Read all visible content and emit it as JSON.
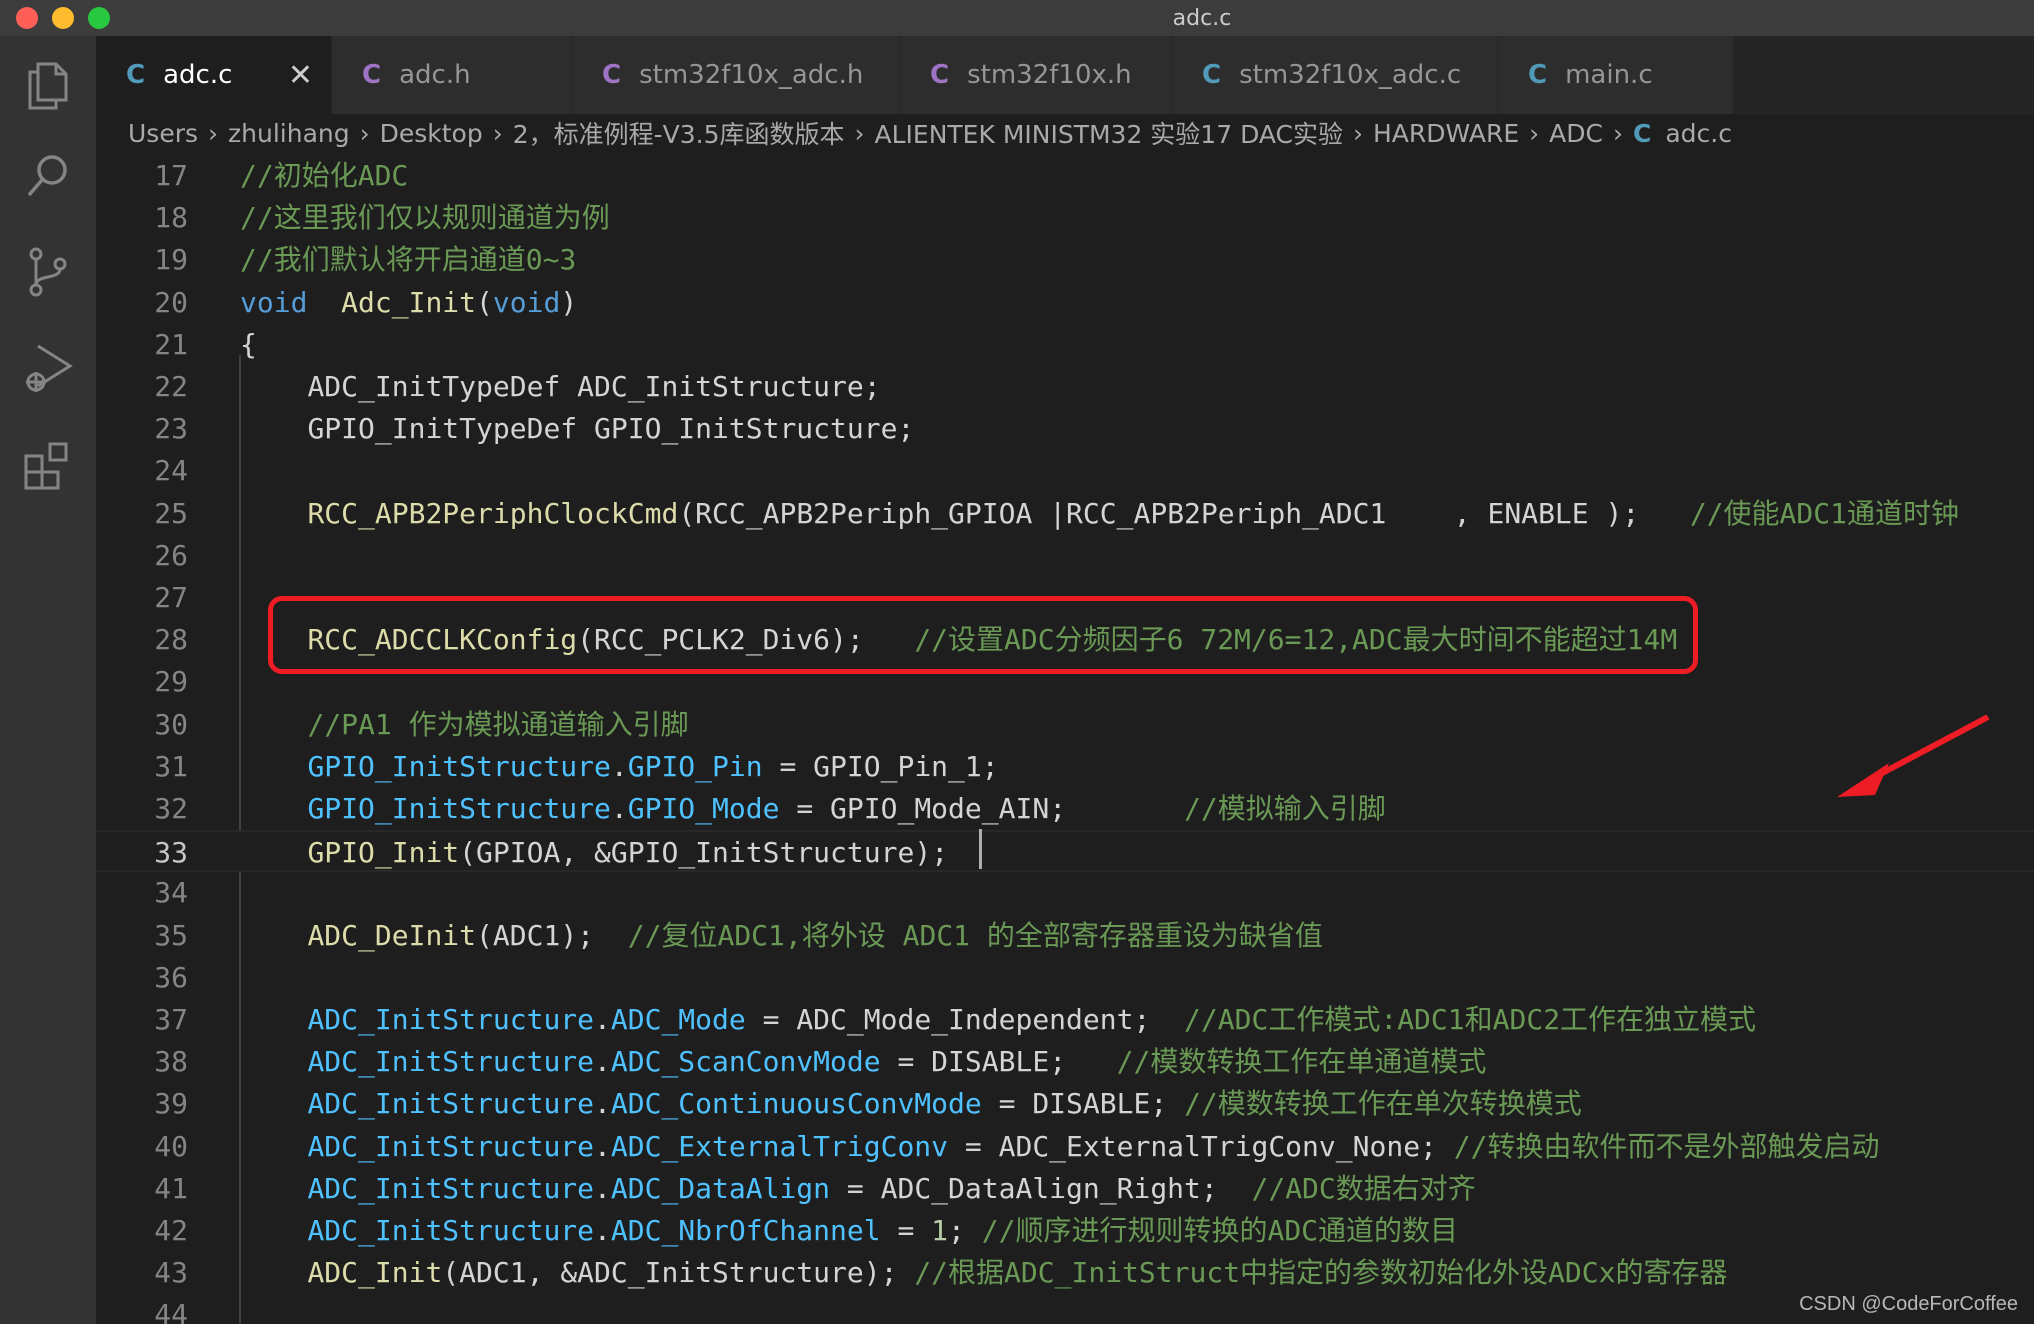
{
  "window": {
    "title": "adc.c"
  },
  "tabs": [
    {
      "label": "adc.c",
      "active": true,
      "icon_color": "#519aba"
    },
    {
      "label": "adc.h",
      "active": false,
      "icon_color": "#a074c4"
    },
    {
      "label": "stm32f10x_adc.h",
      "active": false,
      "icon_color": "#a074c4"
    },
    {
      "label": "stm32f10x.h",
      "active": false,
      "icon_color": "#a074c4"
    },
    {
      "label": "stm32f10x_adc.c",
      "active": false,
      "icon_color": "#519aba"
    },
    {
      "label": "main.c",
      "active": false,
      "icon_color": "#519aba"
    }
  ],
  "tab_icon_letter": "C",
  "breadcrumb": [
    "Users",
    "zhulihang",
    "Desktop",
    "2，标准例程-V3.5库函数版本",
    "ALIENTEK MINISTM32 实验17 DAC实验",
    "HARDWARE",
    "ADC",
    "adc.c"
  ],
  "activity_icons": [
    "files-icon",
    "search-icon",
    "source-control-icon",
    "run-debug-icon",
    "extensions-icon"
  ],
  "current_line": 33,
  "code_lines": [
    {
      "n": "17",
      "t": "//初始化ADC"
    },
    {
      "n": "18",
      "t": "//这里我们仅以规则通道为例"
    },
    {
      "n": "19",
      "t": "//我们默认将开启通道0~3"
    },
    {
      "n": "20",
      "t": "void  Adc_Init(void)"
    },
    {
      "n": "21",
      "t": "{"
    },
    {
      "n": "22",
      "t": "    ADC_InitTypeDef ADC_InitStructure;"
    },
    {
      "n": "23",
      "t": "    GPIO_InitTypeDef GPIO_InitStructure;"
    },
    {
      "n": "24",
      "t": ""
    },
    {
      "n": "25",
      "t": "    RCC_APB2PeriphClockCmd(RCC_APB2Periph_GPIOA |RCC_APB2Periph_ADC1    , ENABLE );   //使能ADC1通道时钟"
    },
    {
      "n": "26",
      "t": ""
    },
    {
      "n": "27",
      "t": ""
    },
    {
      "n": "28",
      "t": "    RCC_ADCCLKConfig(RCC_PCLK2_Div6);   //设置ADC分频因子6 72M/6=12,ADC最大时间不能超过14M"
    },
    {
      "n": "29",
      "t": ""
    },
    {
      "n": "30",
      "t": "    //PA1 作为模拟通道输入引脚"
    },
    {
      "n": "31",
      "t": "    GPIO_InitStructure.GPIO_Pin = GPIO_Pin_1;"
    },
    {
      "n": "32",
      "t": "    GPIO_InitStructure.GPIO_Mode = GPIO_Mode_AIN;       //模拟输入引脚"
    },
    {
      "n": "33",
      "t": "    GPIO_Init(GPIOA, &GPIO_InitStructure);"
    },
    {
      "n": "34",
      "t": ""
    },
    {
      "n": "35",
      "t": "    ADC_DeInit(ADC1);  //复位ADC1,将外设 ADC1 的全部寄存器重设为缺省值"
    },
    {
      "n": "36",
      "t": ""
    },
    {
      "n": "37",
      "t": "    ADC_InitStructure.ADC_Mode = ADC_Mode_Independent;  //ADC工作模式:ADC1和ADC2工作在独立模式"
    },
    {
      "n": "38",
      "t": "    ADC_InitStructure.ADC_ScanConvMode = DISABLE;   //模数转换工作在单通道模式"
    },
    {
      "n": "39",
      "t": "    ADC_InitStructure.ADC_ContinuousConvMode = DISABLE; //模数转换工作在单次转换模式"
    },
    {
      "n": "40",
      "t": "    ADC_InitStructure.ADC_ExternalTrigConv = ADC_ExternalTrigConv_None; //转换由软件而不是外部触发启动"
    },
    {
      "n": "41",
      "t": "    ADC_InitStructure.ADC_DataAlign = ADC_DataAlign_Right;  //ADC数据右对齐"
    },
    {
      "n": "42",
      "t": "    ADC_InitStructure.ADC_NbrOfChannel = 1; //顺序进行规则转换的ADC通道的数目"
    },
    {
      "n": "43",
      "t": "    ADC_Init(ADC1, &ADC_InitStructure); //根据ADC_InitStruct中指定的参数初始化外设ADCx的寄存器"
    },
    {
      "n": "44",
      "t": ""
    }
  ],
  "annotation": {
    "box_color": "#ee1c24",
    "arrow_color": "#ee1c24"
  },
  "watermark": "CSDN @CodeForCoffee"
}
